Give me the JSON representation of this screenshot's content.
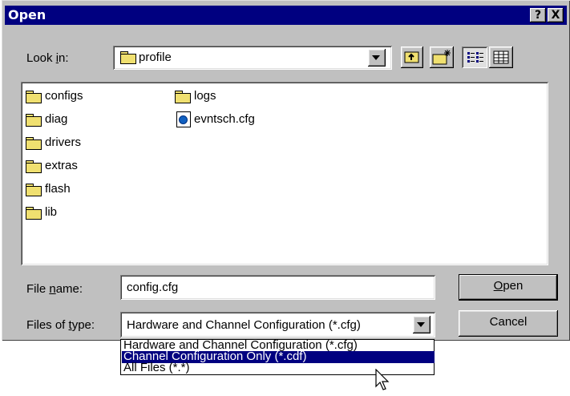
{
  "window": {
    "title": "Open",
    "help_button": "?",
    "close_button": "X"
  },
  "look_in": {
    "label_prefix": "Look ",
    "label_accel": "i",
    "label_suffix": "n:",
    "value": "profile"
  },
  "toolbar": {
    "icons": [
      "up-one-level-icon",
      "create-new-folder-icon",
      "list-view-icon",
      "details-view-icon"
    ]
  },
  "files": {
    "column1": [
      "configs",
      "diag",
      "drivers",
      "extras",
      "flash",
      "lib"
    ],
    "column2_folders": [
      "logs"
    ],
    "column2_files": [
      "evntsch.cfg"
    ]
  },
  "file_name": {
    "label_prefix": "File ",
    "label_accel": "n",
    "label_suffix": "ame:",
    "value": "config.cfg"
  },
  "files_of_type": {
    "label_prefix": "Files of ",
    "label_accel": "t",
    "label_suffix": "ype:",
    "value": "Hardware and Channel Configuration (*.cfg)",
    "options": [
      "Hardware and Channel Configuration (*.cfg)",
      "Channel Configuration Only (*.cdf)",
      "All Files (*.*)"
    ],
    "highlighted_index": 1
  },
  "buttons": {
    "open_accel": "O",
    "open_rest": "pen",
    "cancel": "Cancel"
  },
  "colors": {
    "title_bar": "#000080",
    "face": "#c0c0c0",
    "selection": "#000080"
  }
}
